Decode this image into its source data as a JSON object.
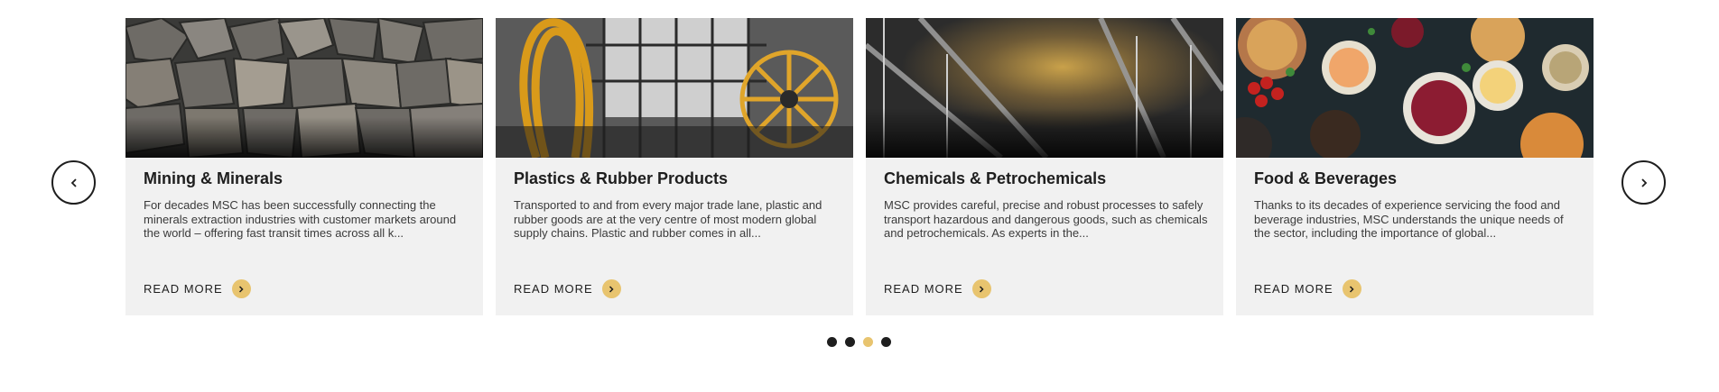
{
  "carousel": {
    "prev_icon": "chevron-left-icon",
    "next_icon": "chevron-right-icon",
    "cards": [
      {
        "title": "Mining & Minerals",
        "text": "For decades MSC has been successfully connecting the minerals extraction industries with customer markets around the world – offering fast transit times across all k...",
        "cta": "READ MORE",
        "image": "rocks-photo"
      },
      {
        "title": "Plastics & Rubber Products",
        "text": "Transported to and from every major trade lane, plastic and rubber goods are at the very centre of most modern global supply chains. Plastic and rubber comes in all...",
        "cta": "READ MORE",
        "image": "factory-cables-photo"
      },
      {
        "title": "Chemicals & Petrochemicals",
        "text": "MSC provides careful, precise and robust processes to safely transport hazardous and dangerous goods, such as chemicals and petrochemicals. As experts in the...",
        "cta": "READ MORE",
        "image": "refinery-photo"
      },
      {
        "title": "Food & Beverages",
        "text": "Thanks to its decades of experience servicing the food and beverage industries, MSC understands the unique needs of the sector, including the importance of global...",
        "cta": "READ MORE",
        "image": "food-table-photo"
      }
    ],
    "pagination": {
      "count": 4,
      "active_index": 2
    },
    "colors": {
      "accent": "#e8c46f",
      "card_bg": "#f1f1f1",
      "text": "#1e1e1e"
    }
  }
}
